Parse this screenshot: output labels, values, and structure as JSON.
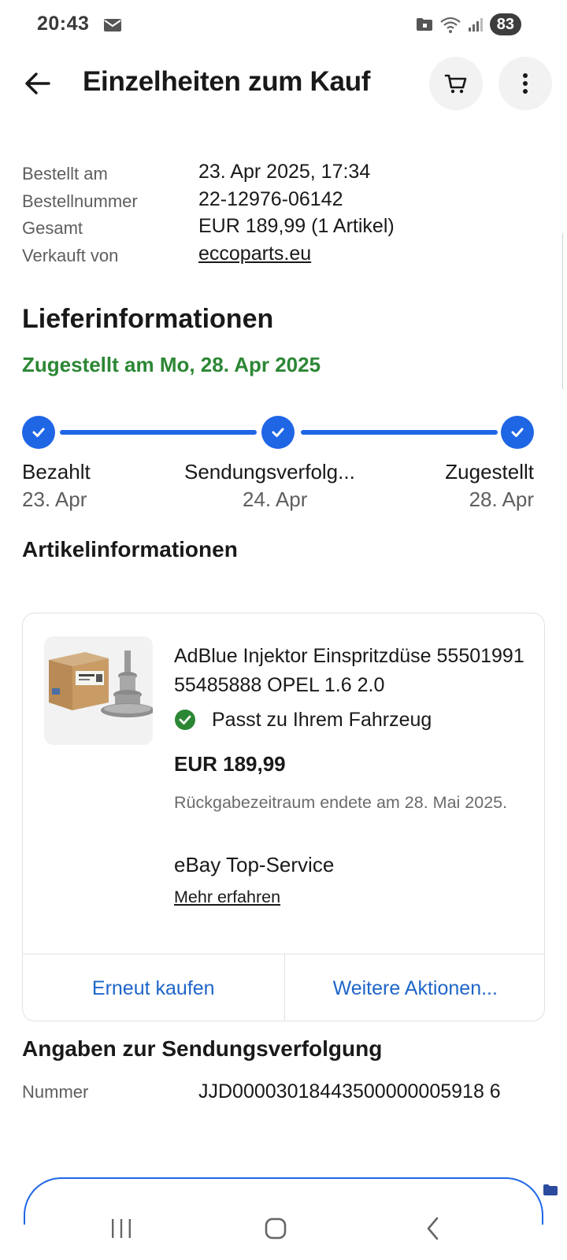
{
  "status_bar": {
    "time": "20:43",
    "battery": "83",
    "network_label": "5"
  },
  "header": {
    "title": "Einzelheiten zum Kauf",
    "back_icon": "arrow-left-icon",
    "cart_icon": "cart-icon",
    "more_icon": "more-vertical-icon"
  },
  "order": {
    "rows": [
      {
        "label": "Bestellt am",
        "value": "23. Apr 2025, 17:34"
      },
      {
        "label": "Bestellnummer",
        "value": "22-12976-06142"
      },
      {
        "label": "Gesamt",
        "value": "EUR 189,99 (1 Artikel)"
      },
      {
        "label": "Verkauft von",
        "value": "eccoparts.eu"
      }
    ]
  },
  "delivery": {
    "title": "Lieferinformationen",
    "status": "Zugestellt am Mo, 28. Apr 2025",
    "status_color": "#2c8735",
    "accent_color": "#1f66e5",
    "steps": [
      {
        "name": "Bezahlt",
        "date": "23. Apr",
        "completed": true
      },
      {
        "name": "Sendungsverfolg...",
        "date": "24. Apr",
        "completed": true
      },
      {
        "name": "Zugestellt",
        "date": "28. Apr",
        "completed": true
      }
    ]
  },
  "item_section": {
    "title": "Artikelinformationen",
    "item": {
      "name": "AdBlue Injektor Einspritzdüse 55501991 55485888 OPEL 1.6 2.0",
      "fit_text": "Passt zu Ihrem Fahrzeug",
      "price": "EUR 189,99",
      "return_info": "Rückgabezeitraum endete am 28. Mai 2025.",
      "service": "eBay Top-Service",
      "more_link": "Mehr erfahren"
    },
    "actions": {
      "buy_again": "Erneut kaufen",
      "more_actions": "Weitere Aktionen..."
    }
  },
  "tracking": {
    "title": "Angaben zur Sendungsverfolgung",
    "label": "Nummer",
    "number": "JJD00003018443500000005918 6"
  }
}
